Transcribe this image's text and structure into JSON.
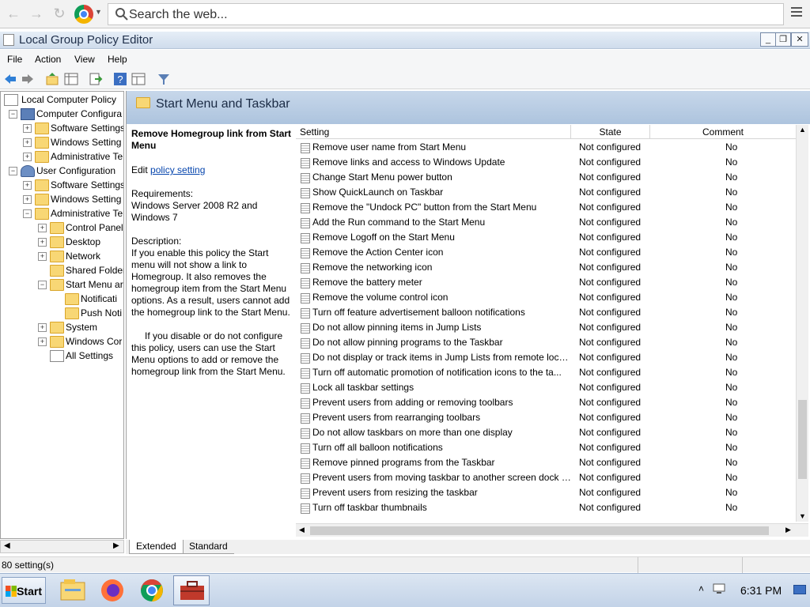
{
  "browser": {
    "search_placeholder": "Search the web..."
  },
  "window": {
    "title": "Local Group Policy Editor",
    "minimize": "_",
    "restore": "❐",
    "close": "✕"
  },
  "menu": [
    "File",
    "Action",
    "View",
    "Help"
  ],
  "tree": [
    {
      "label": "Local Computer Policy",
      "indent": 0,
      "icon": "doc",
      "expander": ""
    },
    {
      "label": "Computer Configura",
      "indent": 1,
      "icon": "pc",
      "expander": "−"
    },
    {
      "label": "Software Settings",
      "indent": 2,
      "icon": "folder",
      "expander": "+"
    },
    {
      "label": "Windows Setting",
      "indent": 2,
      "icon": "folder",
      "expander": "+"
    },
    {
      "label": "Administrative Te",
      "indent": 2,
      "icon": "folder",
      "expander": "+"
    },
    {
      "label": "User Configuration",
      "indent": 1,
      "icon": "user",
      "expander": "−"
    },
    {
      "label": "Software Settings",
      "indent": 2,
      "icon": "folder",
      "expander": "+"
    },
    {
      "label": "Windows Setting",
      "indent": 2,
      "icon": "folder",
      "expander": "+"
    },
    {
      "label": "Administrative Te",
      "indent": 2,
      "icon": "folder",
      "expander": "−"
    },
    {
      "label": "Control Panel",
      "indent": 3,
      "icon": "folder",
      "expander": "+"
    },
    {
      "label": "Desktop",
      "indent": 3,
      "icon": "folder",
      "expander": "+"
    },
    {
      "label": "Network",
      "indent": 3,
      "icon": "folder",
      "expander": "+"
    },
    {
      "label": "Shared Folder",
      "indent": 3,
      "icon": "folder",
      "expander": ""
    },
    {
      "label": "Start Menu ar",
      "indent": 3,
      "icon": "folder",
      "expander": "−"
    },
    {
      "label": "Notificati",
      "indent": 4,
      "icon": "folder",
      "expander": ""
    },
    {
      "label": "Push Noti",
      "indent": 4,
      "icon": "folder",
      "expander": ""
    },
    {
      "label": "System",
      "indent": 3,
      "icon": "folder",
      "expander": "+"
    },
    {
      "label": "Windows Cor",
      "indent": 3,
      "icon": "folder",
      "expander": "+"
    },
    {
      "label": "All Settings",
      "indent": 3,
      "icon": "doc",
      "expander": ""
    }
  ],
  "pane": {
    "title": "Start Menu and Taskbar"
  },
  "description": {
    "title": "Remove Homegroup link from Start Menu",
    "edit_prefix": "Edit ",
    "edit_link": "policy setting",
    "requirements_label": "Requirements:",
    "requirements": "Windows Server 2008 R2 and Windows 7",
    "description_label": "Description:",
    "para1": "If you enable this policy the Start menu will not show a link to Homegroup. It also removes the homegroup item from the Start Menu options. As a result, users cannot add the homegroup link to the Start Menu.",
    "para2": "If you disable or do not configure this policy, users can use the Start Menu options to add or remove the homegroup link from the Start Menu."
  },
  "columns": {
    "setting": "Setting",
    "state": "State",
    "comment": "Comment"
  },
  "settings": [
    {
      "name": "Remove user name from Start Menu",
      "state": "Not configured",
      "comment": "No"
    },
    {
      "name": "Remove links and access to Windows Update",
      "state": "Not configured",
      "comment": "No"
    },
    {
      "name": "Change Start Menu power button",
      "state": "Not configured",
      "comment": "No"
    },
    {
      "name": "Show QuickLaunch on Taskbar",
      "state": "Not configured",
      "comment": "No"
    },
    {
      "name": "Remove the \"Undock PC\" button from the Start Menu",
      "state": "Not configured",
      "comment": "No"
    },
    {
      "name": "Add the Run command to the Start Menu",
      "state": "Not configured",
      "comment": "No"
    },
    {
      "name": "Remove Logoff on the Start Menu",
      "state": "Not configured",
      "comment": "No"
    },
    {
      "name": "Remove the Action Center icon",
      "state": "Not configured",
      "comment": "No"
    },
    {
      "name": "Remove the networking icon",
      "state": "Not configured",
      "comment": "No"
    },
    {
      "name": "Remove the battery meter",
      "state": "Not configured",
      "comment": "No"
    },
    {
      "name": "Remove the volume control icon",
      "state": "Not configured",
      "comment": "No"
    },
    {
      "name": "Turn off feature advertisement balloon notifications",
      "state": "Not configured",
      "comment": "No"
    },
    {
      "name": "Do not allow pinning items in Jump Lists",
      "state": "Not configured",
      "comment": "No"
    },
    {
      "name": "Do not allow pinning programs to the Taskbar",
      "state": "Not configured",
      "comment": "No"
    },
    {
      "name": "Do not display or track items in Jump Lists from remote loca...",
      "state": "Not configured",
      "comment": "No"
    },
    {
      "name": "Turn off automatic promotion of notification icons to the ta...",
      "state": "Not configured",
      "comment": "No"
    },
    {
      "name": "Lock all taskbar settings",
      "state": "Not configured",
      "comment": "No"
    },
    {
      "name": "Prevent users from adding or removing toolbars",
      "state": "Not configured",
      "comment": "No"
    },
    {
      "name": "Prevent users from rearranging toolbars",
      "state": "Not configured",
      "comment": "No"
    },
    {
      "name": "Do not allow taskbars on more than one display",
      "state": "Not configured",
      "comment": "No"
    },
    {
      "name": "Turn off all balloon notifications",
      "state": "Not configured",
      "comment": "No"
    },
    {
      "name": "Remove pinned programs from the Taskbar",
      "state": "Not configured",
      "comment": "No"
    },
    {
      "name": "Prevent users from moving taskbar to another screen dock l...",
      "state": "Not configured",
      "comment": "No"
    },
    {
      "name": "Prevent users from resizing the taskbar",
      "state": "Not configured",
      "comment": "No"
    },
    {
      "name": "Turn off taskbar thumbnails",
      "state": "Not configured",
      "comment": "No"
    }
  ],
  "tabs": {
    "extended": "Extended",
    "standard": "Standard"
  },
  "status": {
    "text": "80 setting(s)"
  },
  "taskbar": {
    "start_label": "Start",
    "clock": "6:31 PM"
  },
  "colors": {
    "pane_header": "#b7cbe3",
    "link": "#0645ad",
    "folder": "#f8d775"
  }
}
